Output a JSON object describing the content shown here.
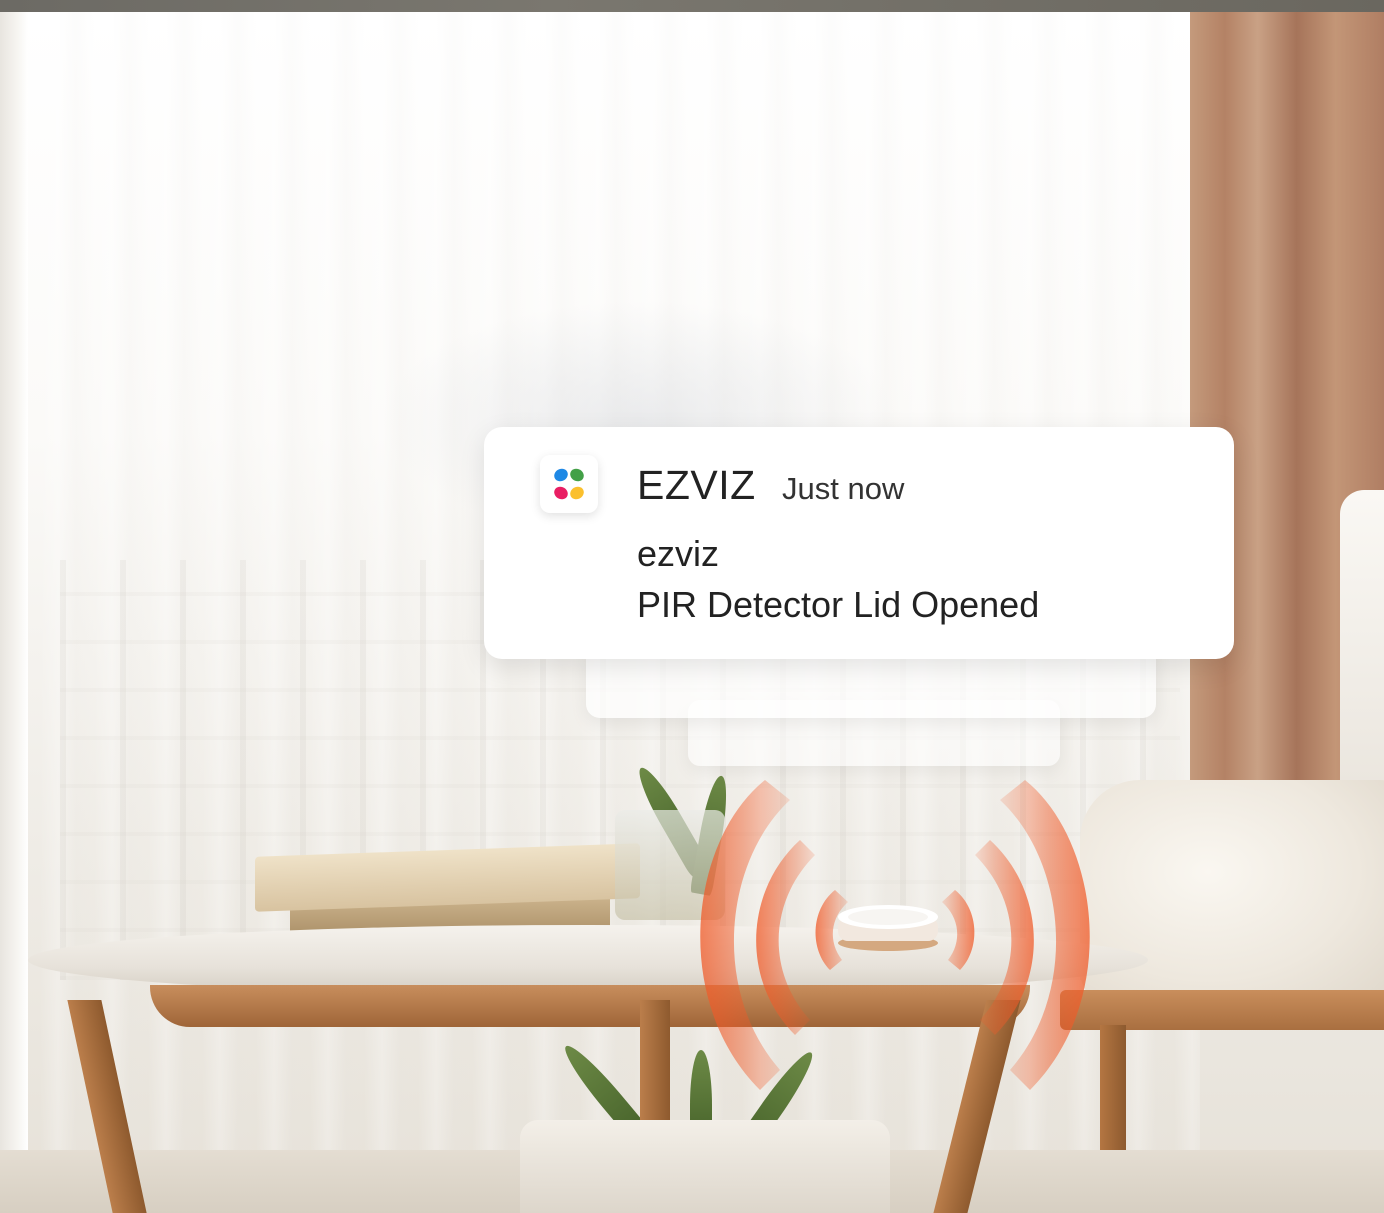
{
  "notification": {
    "app_name": "EZVIZ",
    "timestamp": "Just now",
    "sender": "ezviz",
    "message": "PIR Detector Lid Opened",
    "icon": "ezviz-logo-icon"
  },
  "colors": {
    "wave": "#f05a28",
    "card": "#ffffff",
    "text": "#222222"
  }
}
